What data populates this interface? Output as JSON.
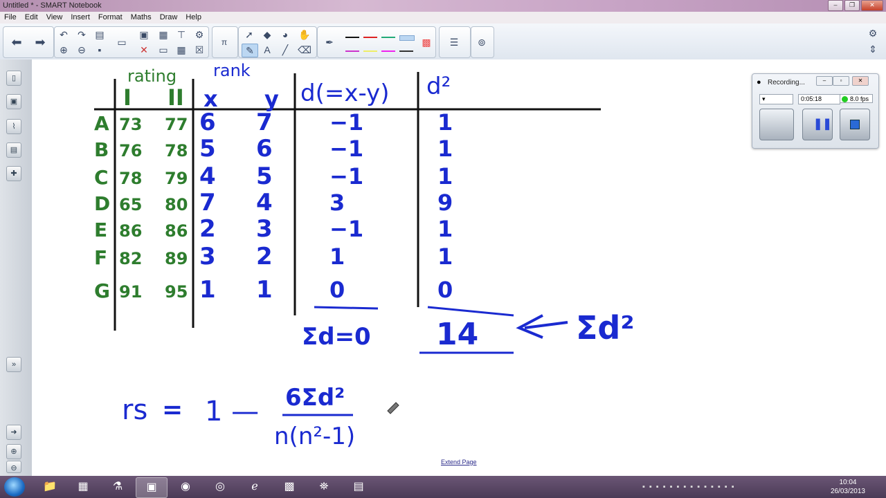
{
  "window": {
    "title": "Untitled * - SMART Notebook"
  },
  "menu": [
    "File",
    "Edit",
    "View",
    "Insert",
    "Format",
    "Maths",
    "Draw",
    "Help"
  ],
  "board": {
    "rating_label": "rating",
    "rank_label": "rank",
    "col_I": "I",
    "col_II": "II",
    "col_x": "x",
    "col_y": "y",
    "col_d": "d(=x-y)",
    "col_d2": "d²",
    "rows": [
      {
        "label": "A",
        "r1": "73",
        "r2": "77",
        "x": "6",
        "y": "7",
        "d": "−1",
        "d2": "1"
      },
      {
        "label": "B",
        "r1": "76",
        "r2": "78",
        "x": "5",
        "y": "6",
        "d": "−1",
        "d2": "1"
      },
      {
        "label": "C",
        "r1": "78",
        "r2": "79",
        "x": "4",
        "y": "5",
        "d": "−1",
        "d2": "1"
      },
      {
        "label": "D",
        "r1": "65",
        "r2": "80",
        "x": "7",
        "y": "4",
        "d": "3",
        "d2": "9"
      },
      {
        "label": "E",
        "r1": "86",
        "r2": "86",
        "x": "2",
        "y": "3",
        "d": "−1",
        "d2": "1"
      },
      {
        "label": "F",
        "r1": "82",
        "r2": "89",
        "x": "3",
        "y": "2",
        "d": "1",
        "d2": "1"
      },
      {
        "label": "G",
        "r1": "91",
        "r2": "95",
        "x": "1",
        "y": "1",
        "d": "0",
        "d2": "0"
      }
    ],
    "sum_d": "Σd=0",
    "sum_d2": "14",
    "sum_d2_label": "Σd²",
    "formula_lhs": "rs",
    "formula_eq": "=",
    "formula_one": "1 —",
    "formula_num": "6Σd²",
    "formula_den": "n(n²-1)"
  },
  "extend_page": "Extend Page",
  "recorder": {
    "title": "Recording...",
    "time": "0:05:18",
    "fps": "8.0 fps"
  },
  "clock": {
    "time": "10:04",
    "date": "26/03/2013"
  },
  "colors": {
    "green_ink": "#2e7d2e",
    "blue_ink": "#1a2ad0"
  }
}
